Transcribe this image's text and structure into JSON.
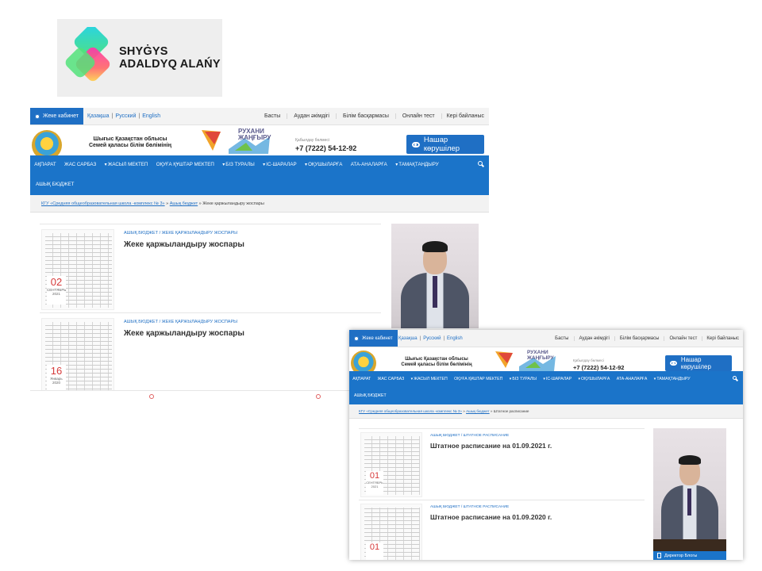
{
  "logo": {
    "line1": "SHYĠYS",
    "line2": "ADALDYQ ALAŃY",
    "colors": {
      "cyan": "#27d3e8",
      "green": "#52e27a",
      "magenta": "#ff2fb4",
      "yellow": "#ffe04a"
    }
  },
  "site": {
    "topbar": {
      "cabinet_label": "Жеке кабинет",
      "languages": [
        "Қазақша",
        "Русский",
        "English"
      ],
      "links": [
        "Басты",
        "Аудан әкімдігі",
        "Білім басқармасы",
        "Онлайн тест",
        "Кері байланыс"
      ]
    },
    "header": {
      "title_line1": "Шығыс Қазақстан облысы",
      "title_line2": "Семей қаласы білім бөлімінің",
      "ruhani_line1": "РУХАНИ",
      "ruhani_line2": "ЖАҢҒЫРУ",
      "phone_label": "Қабылдау бөлмесі",
      "phone": "+7 (7222) 54-12-92",
      "guide_button": "Нашар көрушілер"
    },
    "nav": {
      "items": [
        {
          "label": "АҚПАРАТ",
          "dropdown": false
        },
        {
          "label": "ЖАС САРБАЗ",
          "dropdown": false
        },
        {
          "label": "ЖАСЫЛ МЕКТЕП",
          "dropdown": true
        },
        {
          "label": "ОҚУҒА ҚҰШТАР МЕКТЕП",
          "dropdown": false
        },
        {
          "label": "БІЗ ТУРАЛЫ",
          "dropdown": true
        },
        {
          "label": "ІС-ШАРАЛАР",
          "dropdown": true
        },
        {
          "label": "ОҚУШЫЛАРҒА",
          "dropdown": true
        },
        {
          "label": "АТА-АНАЛАРҒА",
          "dropdown": false
        },
        {
          "label": "ТАМАҚТАНДЫРУ",
          "dropdown": true
        }
      ],
      "second_row": "АШЫҚ БЮДЖЕТ",
      "search_icon": "search-icon"
    },
    "accent_color": "#1b74c9"
  },
  "screenshot_a": {
    "breadcrumb": {
      "link1": "КГУ «Средняя общеобразовательная школа -комплекс № 3»",
      "sep": " » ",
      "link2": "Ашық бюджет",
      "current": "Жеке қаржыландыру жоспары"
    },
    "articles": [
      {
        "category": "АШЫҚ БЮДЖЕТ / ЖЕКЕ ҚАРЖЫЛАНДЫРУ ЖОСПАРЫ",
        "title": "Жеке қаржыландыру жоспары",
        "day": "02",
        "month": "СЕНТЯБРЬ",
        "year": "2021"
      },
      {
        "category": "АШЫҚ БЮДЖЕТ / ЖЕКЕ ҚАРЖЫЛАНДЫРУ ЖОСПАРЫ",
        "title": "Жеке қаржыландыру жоспары",
        "day": "16",
        "month": "Январь",
        "year": "2020"
      }
    ]
  },
  "screenshot_b": {
    "breadcrumb": {
      "link1": "КГУ «Средняя общеобразовательная школа -комплекс № 3»",
      "sep": " » ",
      "link2": "Ашық бюджет",
      "current": "Штатное расписание"
    },
    "articles": [
      {
        "category": "АШЫҚ БЮДЖЕТ / ШТАТНОЕ РАСПИСАНИЕ",
        "title": "Штатное расписание на 01.09.2021 г.",
        "day": "01",
        "month": "СЕНТЯБРЬ",
        "year": "2021"
      },
      {
        "category": "АШЫҚ БЮДЖЕТ / ШТАТНОЕ РАСПИСАНИЕ",
        "title": "Штатное расписание на 01.09.2020 г.",
        "day": "01",
        "month": "",
        "year": ""
      }
    ],
    "photo_caption": "Директор Блогы"
  }
}
